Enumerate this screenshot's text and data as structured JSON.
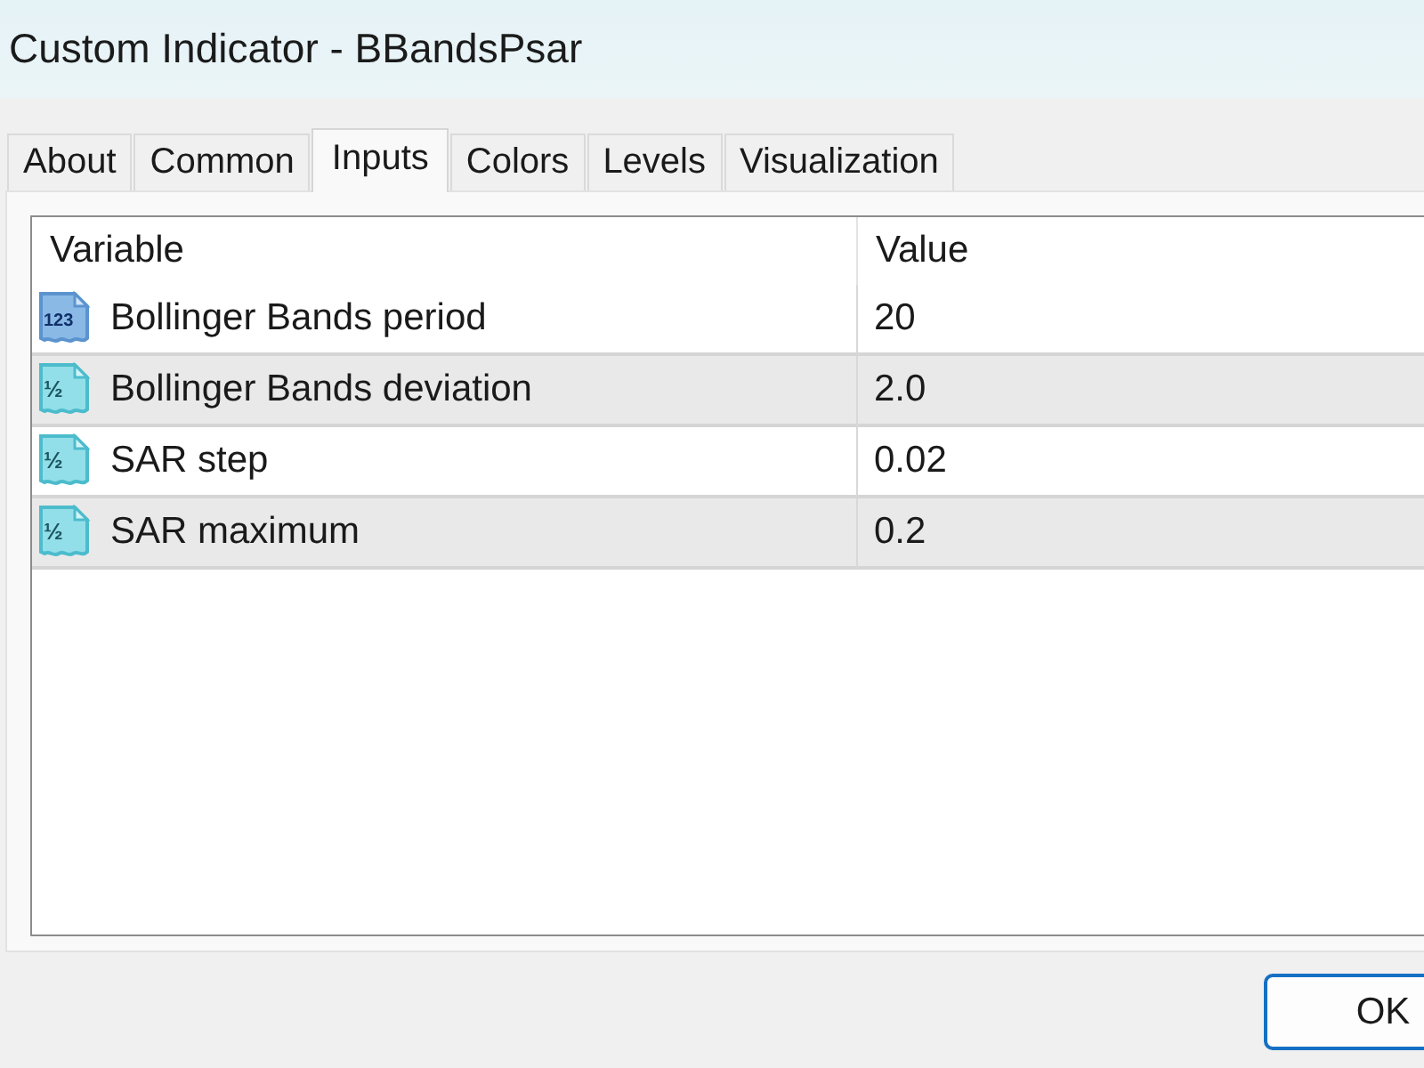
{
  "window": {
    "title": "Custom Indicator - BBandsPsar"
  },
  "tabs": [
    {
      "label": "About",
      "selected": false
    },
    {
      "label": "Common",
      "selected": false
    },
    {
      "label": "Inputs",
      "selected": true
    },
    {
      "label": "Colors",
      "selected": false
    },
    {
      "label": "Levels",
      "selected": false
    },
    {
      "label": "Visualization",
      "selected": false
    }
  ],
  "table": {
    "columns": [
      "Variable",
      "Value"
    ],
    "rows": [
      {
        "kind": "integer",
        "icon_label": "123",
        "variable": "Bollinger Bands period",
        "value": "20"
      },
      {
        "kind": "double",
        "icon_label": "½",
        "variable": "Bollinger Bands deviation",
        "value": "2.0"
      },
      {
        "kind": "double",
        "icon_label": "½",
        "variable": "SAR step",
        "value": "0.02"
      },
      {
        "kind": "double",
        "icon_label": "½",
        "variable": "SAR maximum",
        "value": "0.2"
      }
    ]
  },
  "buttons": [
    {
      "label": "OK"
    }
  ]
}
